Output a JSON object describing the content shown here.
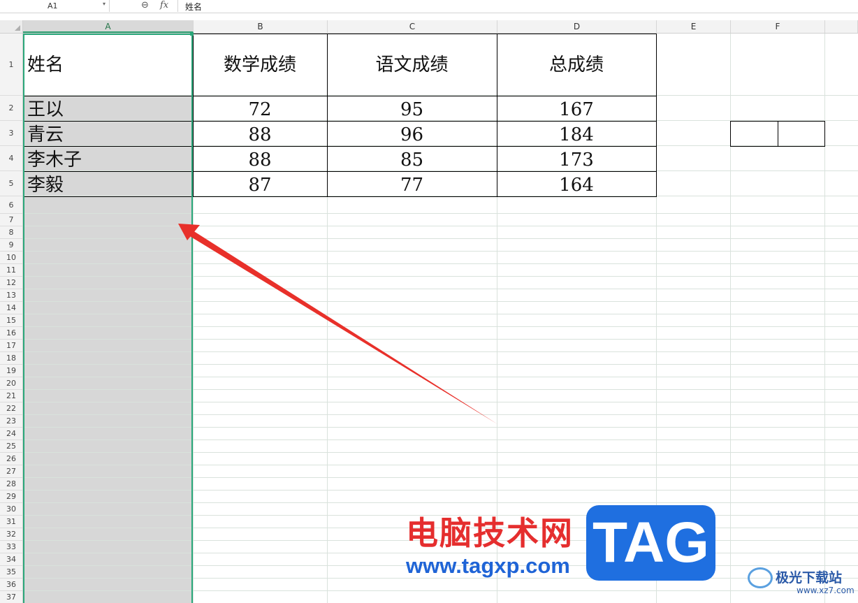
{
  "formula_bar": {
    "name_box": "A1",
    "formula": "姓名"
  },
  "columns": [
    "A",
    "B",
    "C",
    "D",
    "E",
    "F"
  ],
  "rows": [
    "1",
    "2",
    "3",
    "4",
    "5",
    "6",
    "7",
    "8",
    "9",
    "10",
    "11",
    "12",
    "13",
    "14",
    "15",
    "16",
    "17",
    "18",
    "19",
    "20",
    "21",
    "22",
    "23",
    "24",
    "25",
    "26",
    "27",
    "28",
    "29",
    "30",
    "31",
    "32",
    "33",
    "34",
    "35",
    "36",
    "37"
  ],
  "table": {
    "headers": [
      "姓名",
      "数学成绩",
      "语文成绩",
      "总成绩"
    ],
    "rows": [
      [
        "王以",
        "72",
        "95",
        "167"
      ],
      [
        "青云",
        "88",
        "96",
        "184"
      ],
      [
        "李木子",
        "88",
        "85",
        "173"
      ],
      [
        "李毅",
        "87",
        "77",
        "164"
      ]
    ]
  },
  "colors": {
    "selection": "#2aa77a",
    "selected_fill": "#d7d7d7",
    "arrow": "#e8302a"
  },
  "icons": {
    "zoom": "zoom-icon",
    "fx": "fx-icon",
    "select_all": "select-all-icon"
  },
  "watermark": {
    "cn_title": "电脑技术网",
    "url": "www.tagxp.com",
    "tag": "TAG",
    "site_name": "极光下载站",
    "site_url": "www.xz7.com"
  }
}
